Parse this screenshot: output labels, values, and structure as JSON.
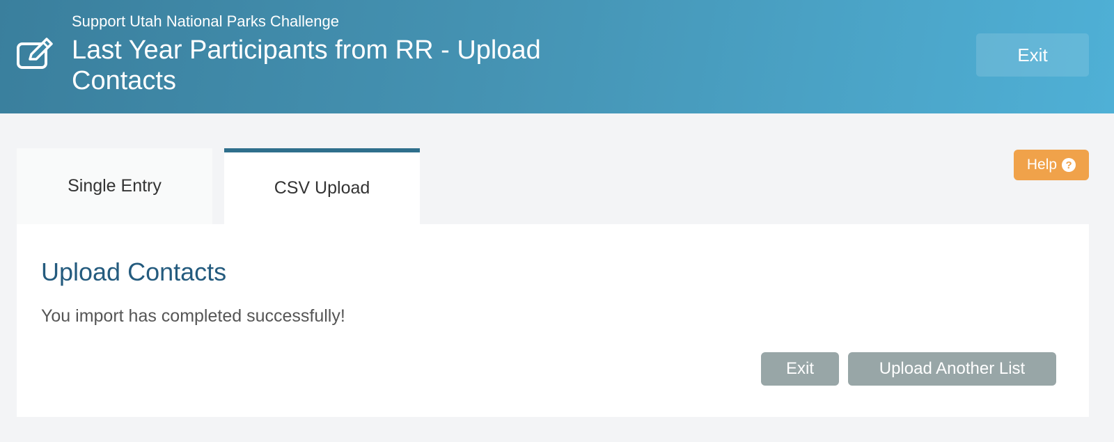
{
  "header": {
    "subtitle": "Support Utah National Parks Challenge",
    "title": "Last Year Participants from RR - Upload Contacts",
    "exit_label": "Exit",
    "icon": "edit-icon"
  },
  "tabs": [
    {
      "label": "Single Entry",
      "active": false
    },
    {
      "label": "CSV Upload",
      "active": true
    }
  ],
  "help": {
    "label": "Help",
    "icon": "question-circle-icon"
  },
  "panel": {
    "title": "Upload Contacts",
    "message": "You import has completed successfully!",
    "exit_label": "Exit",
    "upload_another_label": "Upload Another List"
  },
  "colors": {
    "header_gradient_start": "#3a7f9d",
    "header_gradient_end": "#4fb0d6",
    "active_tab_border": "#2f6f8c",
    "help_button": "#f0a24a",
    "gray_button": "#98a6a7",
    "panel_title": "#245b7e"
  }
}
